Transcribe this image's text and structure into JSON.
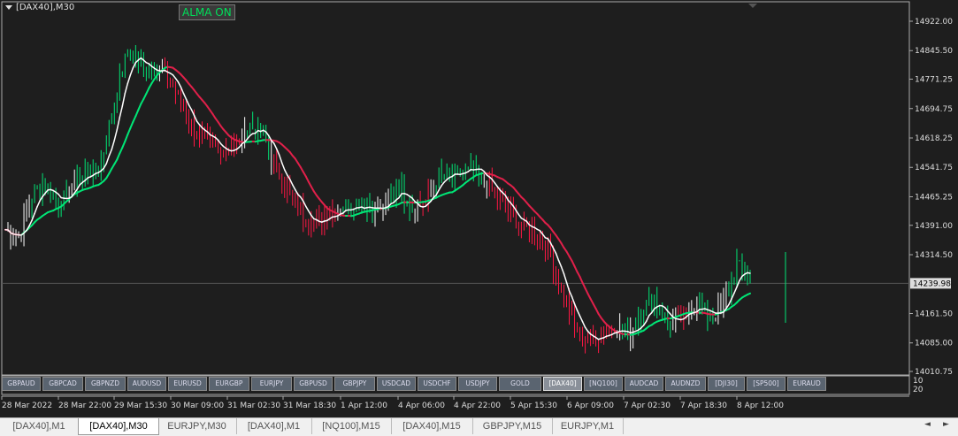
{
  "window": {
    "title": "[DAX40],M30"
  },
  "indicator_button": {
    "label": "ALMA ON"
  },
  "price_axis": {
    "ticks": [
      "14922.00",
      "14845.50",
      "14771.25",
      "14694.75",
      "14618.25",
      "14541.75",
      "14465.25",
      "14391.00",
      "14314.50",
      "14161.50",
      "14085.00",
      "14010.75"
    ],
    "current_price": "14239.98",
    "min": 14010.75,
    "max": 14922.0
  },
  "subwindow_axis": {
    "ticks": [
      "10",
      "20"
    ]
  },
  "time_axis": {
    "labels": [
      "28 Mar 2022",
      "28 Mar 22:00",
      "29 Mar 15:30",
      "30 Mar 09:00",
      "31 Mar 02:30",
      "31 Mar 18:30",
      "1 Apr 12:00",
      "4 Apr 06:00",
      "4 Apr 22:00",
      "5 Apr 15:30",
      "6 Apr 09:00",
      "7 Apr 02:30",
      "7 Apr 18:30",
      "8 Apr 12:00"
    ]
  },
  "symbol_buttons": [
    "GBPAUD",
    "GBPCAD",
    "GBPNZD",
    "AUDUSD",
    "EURUSD",
    "EURGBP",
    "EURJPY",
    "GBPUSD",
    "GBPJPY",
    "USDCAD",
    "USDCHF",
    "USDJPY",
    "GOLD",
    "[DAX40]",
    "[NQ100]",
    "AUDCAD",
    "AUDNZD",
    "[DJI30]",
    "[SP500]",
    "EURAUD"
  ],
  "active_symbol": "[DAX40]",
  "tabs": [
    "[DAX40],M1",
    "[DAX40],M30",
    "EURJPY,M30",
    "[DAX40],M1",
    "[NQ100],M15",
    "[DAX40],M15",
    "GBPJPY,M15",
    "EURJPY,M1"
  ],
  "active_tab": "[DAX40],M30",
  "colors": {
    "bull": "#00e676",
    "bear": "#ff1744",
    "neutral": "#ffffff",
    "ma_fast": "#ffffff",
    "ma_slow_up": "#00e676",
    "ma_slow_down": "#e0204a",
    "background": "#1e1e1e"
  },
  "chart_data": {
    "type": "candlestick-bars",
    "series": [
      {
        "name": "price",
        "points": [
          [
            0,
            14380
          ],
          [
            2,
            14360
          ],
          [
            4,
            14470
          ],
          [
            6,
            14500
          ],
          [
            8,
            14440
          ],
          [
            10,
            14505
          ],
          [
            12,
            14525
          ],
          [
            14,
            14540
          ],
          [
            16,
            14700
          ],
          [
            18,
            14840
          ],
          [
            20,
            14810
          ],
          [
            22,
            14800
          ],
          [
            24,
            14780
          ],
          [
            26,
            14700
          ],
          [
            28,
            14640
          ],
          [
            30,
            14600
          ],
          [
            32,
            14585
          ],
          [
            34,
            14600
          ],
          [
            36,
            14650
          ],
          [
            38,
            14625
          ],
          [
            40,
            14540
          ],
          [
            42,
            14470
          ],
          [
            44,
            14420
          ],
          [
            46,
            14395
          ],
          [
            48,
            14430
          ],
          [
            50,
            14440
          ],
          [
            52,
            14450
          ],
          [
            54,
            14440
          ],
          [
            56,
            14430
          ],
          [
            58,
            14500
          ],
          [
            60,
            14440
          ],
          [
            62,
            14450
          ],
          [
            64,
            14520
          ],
          [
            66,
            14510
          ],
          [
            68,
            14535
          ],
          [
            70,
            14520
          ],
          [
            72,
            14480
          ],
          [
            74,
            14430
          ],
          [
            76,
            14390
          ],
          [
            78,
            14380
          ],
          [
            80,
            14340
          ],
          [
            82,
            14230
          ],
          [
            84,
            14130
          ],
          [
            86,
            14090
          ],
          [
            88,
            14110
          ],
          [
            90,
            14130
          ],
          [
            92,
            14100
          ],
          [
            94,
            14170
          ],
          [
            96,
            14200
          ],
          [
            98,
            14130
          ],
          [
            100,
            14150
          ],
          [
            102,
            14190
          ],
          [
            104,
            14150
          ],
          [
            106,
            14180
          ],
          [
            108,
            14290
          ],
          [
            110,
            14240
          ]
        ]
      }
    ]
  }
}
